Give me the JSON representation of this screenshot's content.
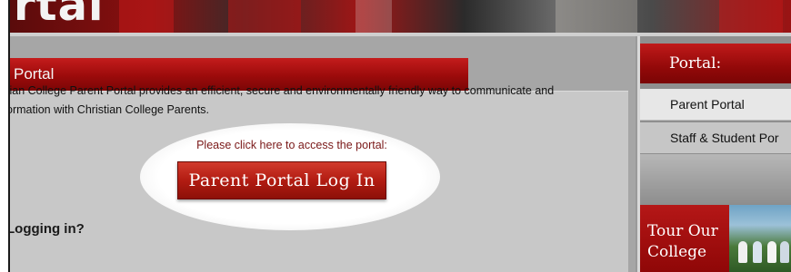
{
  "banner": {
    "title": "rtal"
  },
  "main": {
    "header_title": "Portal",
    "intro_line1": "tian College Parent Portal provides an efficient, secure and environmentally friendly way to communicate and",
    "intro_line2": "ormation with Christian College Parents.",
    "access_prompt": "Please click here to access the portal:",
    "login_button": "Parent Portal Log In",
    "logging_heading": "Logging in?"
  },
  "sidebar": {
    "header": "Portal:",
    "items": [
      {
        "label": "Parent Portal"
      },
      {
        "label": "Staff & Student Por"
      }
    ],
    "tour_line1": "Tour Our",
    "tour_line2": "College"
  }
}
